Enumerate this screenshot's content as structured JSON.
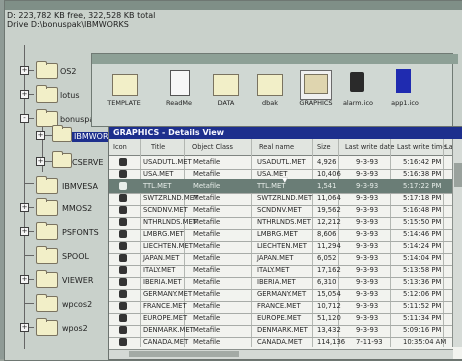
{
  "tree": {
    "status_line1": "D:  223,782 KB free,  322,528 KB total",
    "status_line2": "Drive D:\\bonuspak\\IBMWORKS",
    "items": [
      {
        "label": "OS2"
      },
      {
        "label": "lotus"
      },
      {
        "label": "bonuspak"
      },
      {
        "label": "IBMWORKS"
      },
      {
        "label": "CSERVE"
      },
      {
        "label": "IBMVESA"
      },
      {
        "label": "MMOS2"
      },
      {
        "label": "PSFONTS"
      },
      {
        "label": "SPOOL"
      },
      {
        "label": "VIEWER"
      },
      {
        "label": "wpcos2"
      },
      {
        "label": "wpos2"
      }
    ]
  },
  "icon_view": {
    "items": [
      {
        "label": "TEMPLATE",
        "icon": "folder-icon"
      },
      {
        "label": "ReadMe",
        "icon": "document-icon"
      },
      {
        "label": "DATA",
        "icon": "folder-icon"
      },
      {
        "label": "dbak",
        "icon": "folder-icon"
      },
      {
        "label": "GRAPHICS",
        "icon": "folder-icon"
      },
      {
        "label": "alarm.ico",
        "icon": "alarm-icon"
      },
      {
        "label": "app1.ico",
        "icon": "app-icon"
      }
    ]
  },
  "details": {
    "title": "GRAPHICS - Details View",
    "columns": [
      "Icon",
      "Title",
      "Object Class",
      "Real name",
      "Size",
      "Last write date",
      "Last write time",
      "Last a"
    ],
    "rows": [
      {
        "title": "USADUTL.MET",
        "class": "Metafile",
        "real": "USADUTL.MET",
        "size": "4,926",
        "date": "9-3-93",
        "time": "5:16:42 PM"
      },
      {
        "title": "USA.MET",
        "class": "Metafile",
        "real": "USA.MET",
        "size": "10,406",
        "date": "9-3-93",
        "time": "5:16:38 PM"
      },
      {
        "title": "TTL.MET",
        "class": "Metafile",
        "real": "TTL.MET",
        "size": "1,541",
        "date": "9-3-93",
        "time": "5:17:22 PM",
        "selected": true
      },
      {
        "title": "SWTZRLND.MET",
        "class": "Metafile",
        "real": "SWTZRLND.MET",
        "size": "11,064",
        "date": "9-3-93",
        "time": "5:17:18 PM"
      },
      {
        "title": "SCNDNV.MET",
        "class": "Metafile",
        "real": "SCNDNV.MET",
        "size": "19,562",
        "date": "9-3-93",
        "time": "5:16:48 PM"
      },
      {
        "title": "NTHRLNDS.MET",
        "class": "Metafile",
        "real": "NTHRLNDS.MET",
        "size": "12,212",
        "date": "9-3-93",
        "time": "5:15:50 PM"
      },
      {
        "title": "LMBRG.MET",
        "class": "Metafile",
        "real": "LMBRG.MET",
        "size": "8,606",
        "date": "9-3-93",
        "time": "5:14:46 PM"
      },
      {
        "title": "LIECHTEN.MET",
        "class": "Metafile",
        "real": "LIECHTEN.MET",
        "size": "11,294",
        "date": "9-3-93",
        "time": "5:14:24 PM"
      },
      {
        "title": "JAPAN.MET",
        "class": "Metafile",
        "real": "JAPAN.MET",
        "size": "6,052",
        "date": "9-3-93",
        "time": "5:14:04 PM"
      },
      {
        "title": "ITALY.MET",
        "class": "Metafile",
        "real": "ITALY.MET",
        "size": "17,162",
        "date": "9-3-93",
        "time": "5:13:58 PM"
      },
      {
        "title": "IBERIA.MET",
        "class": "Metafile",
        "real": "IBERIA.MET",
        "size": "6,310",
        "date": "9-3-93",
        "time": "5:13:36 PM"
      },
      {
        "title": "GERMANY.MET",
        "class": "Metafile",
        "real": "GERMANY.MET",
        "size": "15,054",
        "date": "9-3-93",
        "time": "5:12:06 PM"
      },
      {
        "title": "FRANCE.MET",
        "class": "Metafile",
        "real": "FRANCE.MET",
        "size": "10,712",
        "date": "9-3-93",
        "time": "5:11:52 PM"
      },
      {
        "title": "EUROPE.MET",
        "class": "Metafile",
        "real": "EUROPE.MET",
        "size": "51,120",
        "date": "9-3-93",
        "time": "5:11:34 PM"
      },
      {
        "title": "DENMARK.MET",
        "class": "Metafile",
        "real": "DENMARK.MET",
        "size": "13,432",
        "date": "9-3-93",
        "time": "5:09:16 PM"
      },
      {
        "title": "CANADA.MET",
        "class": "Metafile",
        "real": "CANADA.MET",
        "size": "114,136",
        "date": "7-11-93",
        "time": "10:35:04 AM"
      }
    ]
  },
  "colors": {
    "title_active": "#1d2f8d",
    "selected_row": "#6a7d76",
    "window_bg": "#f2f3ef"
  }
}
